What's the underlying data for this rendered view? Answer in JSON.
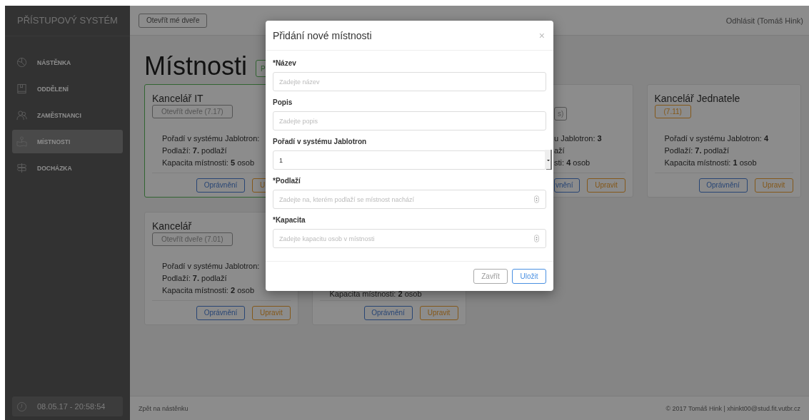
{
  "sidebar": {
    "title": "PŘÍSTUPOVÝ SYSTÉM",
    "items": [
      {
        "label": "NÁSTĚNKA",
        "selected": false
      },
      {
        "label": "ODDĚLENÍ",
        "selected": false
      },
      {
        "label": "ZAMĚSTNANCI",
        "selected": false
      },
      {
        "label": "MÍSTNOSTI",
        "selected": true
      },
      {
        "label": "DOCHÁZKA",
        "selected": false
      }
    ],
    "clock": "08.05.17 - 20:58:54"
  },
  "topbar": {
    "open_button": "Otevřít mé dveře",
    "logout": "Odhlásit (Tomáš Hink)"
  },
  "page": {
    "heading": "Místnosti",
    "add_button": "P"
  },
  "cards": [
    {
      "kind": "covered_right",
      "highlighted": true,
      "title": "Kancelář IT",
      "door": "Otevřít dveře (7.17)",
      "door_warning": false,
      "lines": [
        "Pořadí v systému Jablotron:",
        "Podlaží: **7.** podlaží",
        "Kapacita místnosti: **5** osob"
      ],
      "permissions": "Oprávnění",
      "edit": "U"
    },
    {
      "kind": "covered_left",
      "highlighted": false,
      "door": "s)",
      "door_warning": false,
      "lines": [
        "u Jablotron: **3**",
        "aží",
        "sti: **4** osob"
      ],
      "permissions": "vnění",
      "edit": "Upravit"
    },
    {
      "kind": "full",
      "highlighted": false,
      "title": "Kancelář Jednatele",
      "door": "(7.11)",
      "door_warning": true,
      "lines": [
        "Pořadí v systému Jablotron: **4**",
        "Podlaží: **7.** podlaží",
        "Kapacita místnosti: **1** osob"
      ],
      "permissions": "Oprávnění",
      "edit": "Upravit"
    },
    {
      "kind": "covered_right",
      "highlighted": false,
      "title": "Kancelář",
      "door": "Otevřít dveře (7.01)",
      "door_warning": false,
      "lines": [
        "Pořadí v systému Jablotron:",
        "Podlaží: **7.** podlaží",
        "Kapacita místnosti: **2** osob"
      ],
      "permissions": "Oprávnění",
      "edit": "Upravit"
    },
    {
      "kind": "covered_top",
      "highlighted": false,
      "lines": [
        "Kapacita místnosti: **2** osob"
      ],
      "permissions": "Oprávnění",
      "edit": "Upravit"
    }
  ],
  "modal": {
    "title": "Přidání nové místnosti",
    "close": "×",
    "fields": [
      {
        "label": "*Název",
        "kind": "text",
        "placeholder": "Zadejte název"
      },
      {
        "label": "Popis",
        "kind": "text",
        "placeholder": "Zadejte popis"
      },
      {
        "label": "Pořadí v systému Jablotron",
        "kind": "stepper",
        "value": "1"
      },
      {
        "label": "*Podlaží",
        "kind": "number",
        "placeholder": "Zadejte na, kterém podlaží se místnost nachází"
      },
      {
        "label": "*Kapacita",
        "kind": "number",
        "placeholder": "Zadejte kapacitu osob v místnosti"
      }
    ],
    "close_button": "Zavřít",
    "save_button": "Uložit"
  },
  "footer": {
    "back_link": "Zpět na nástěnku",
    "copyright": "© 2017 Tomáš Hink | xhinkt00@stud.fit.vutbr.cz"
  }
}
